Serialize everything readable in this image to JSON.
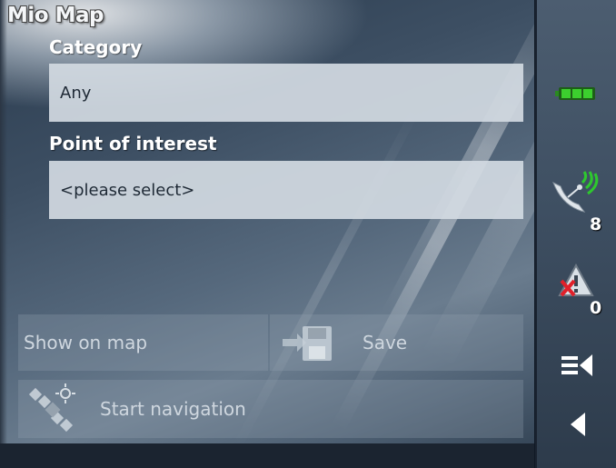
{
  "app": {
    "title": "Mio Map"
  },
  "form": {
    "category_label": "Category",
    "category_value": "Any",
    "poi_label": "Point of interest",
    "poi_value": "<please select>"
  },
  "actions": {
    "show_on_map": "Show on map",
    "save": "Save",
    "start_navigation": "Start navigation"
  },
  "status": {
    "battery_icon": "battery-full-icon",
    "gps_satellites": "8",
    "warnings": "0"
  },
  "colors": {
    "battery": "#3ccf2e",
    "gps": "#2ec82e",
    "warning_x": "#e0202a"
  }
}
